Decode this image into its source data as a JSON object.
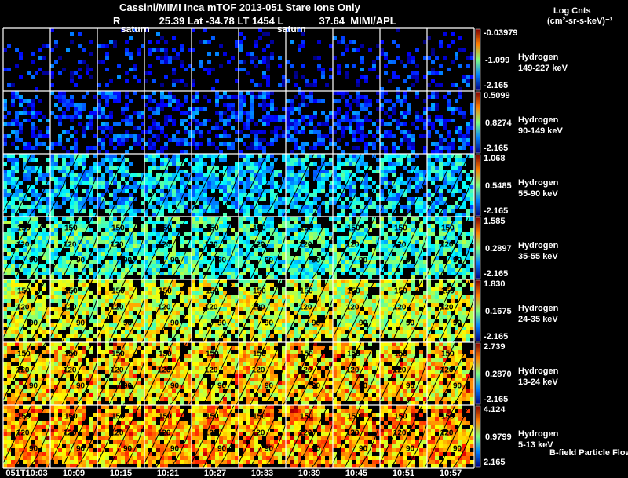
{
  "chart_data": {
    "type": "heatmap",
    "title": "Cassini/MIMI Inca mTOF  2013-051    Stare   Ions Only",
    "subtitle": {
      "r_label": "R",
      "r_sub": "saturn",
      "r_value": "25.39",
      "lat": "Lat -34.78",
      "lt": "LT 1454",
      "l_label": "L",
      "l_sub": "saturn",
      "l_value": "37.64",
      "source": "MIMI/APL"
    },
    "colorbar_title": [
      "Log Cnts",
      "(cm²-sr-s-keV)⁻¹"
    ],
    "colormap": "rainbow (blue-cyan-green-yellow-red), black = no data",
    "times": [
      "051T10:03",
      "10:09",
      "10:15",
      "10:21",
      "10:27",
      "10:33",
      "10:39",
      "10:45",
      "10:51",
      "10:57"
    ],
    "rows": [
      {
        "species": "Hydrogen",
        "energy": "149-227 keV",
        "cb_max": "-0.03979",
        "cb_mid": "-1.099",
        "cb_min": "-2.165"
      },
      {
        "species": "Hydrogen",
        "energy": "90-149 keV",
        "cb_max": "0.5099",
        "cb_mid": "0.8274",
        "cb_min": "-2.165"
      },
      {
        "species": "Hydrogen",
        "energy": "55-90 keV",
        "cb_max": "1.068",
        "cb_mid": "0.5485",
        "cb_min": "-2.165"
      },
      {
        "species": "Hydrogen",
        "energy": "35-55 keV",
        "cb_max": "1.585",
        "cb_mid": "0.2897",
        "cb_min": "-2.165"
      },
      {
        "species": "Hydrogen",
        "energy": "24-35 keV",
        "cb_max": "1.830",
        "cb_mid": "0.1675",
        "cb_min": "-2.165"
      },
      {
        "species": "Hydrogen",
        "energy": "13-24 keV",
        "cb_max": "2.739",
        "cb_mid": "0.2870",
        "cb_min": "-2.165"
      },
      {
        "species": "Hydrogen",
        "energy": "5-13 keV",
        "cb_max": "4.124",
        "cb_mid": "0.9799",
        "cb_min": "2.165"
      }
    ],
    "contour_labels": [
      "150",
      "120",
      "90"
    ],
    "legend_note": "B-field Particle Flow"
  }
}
